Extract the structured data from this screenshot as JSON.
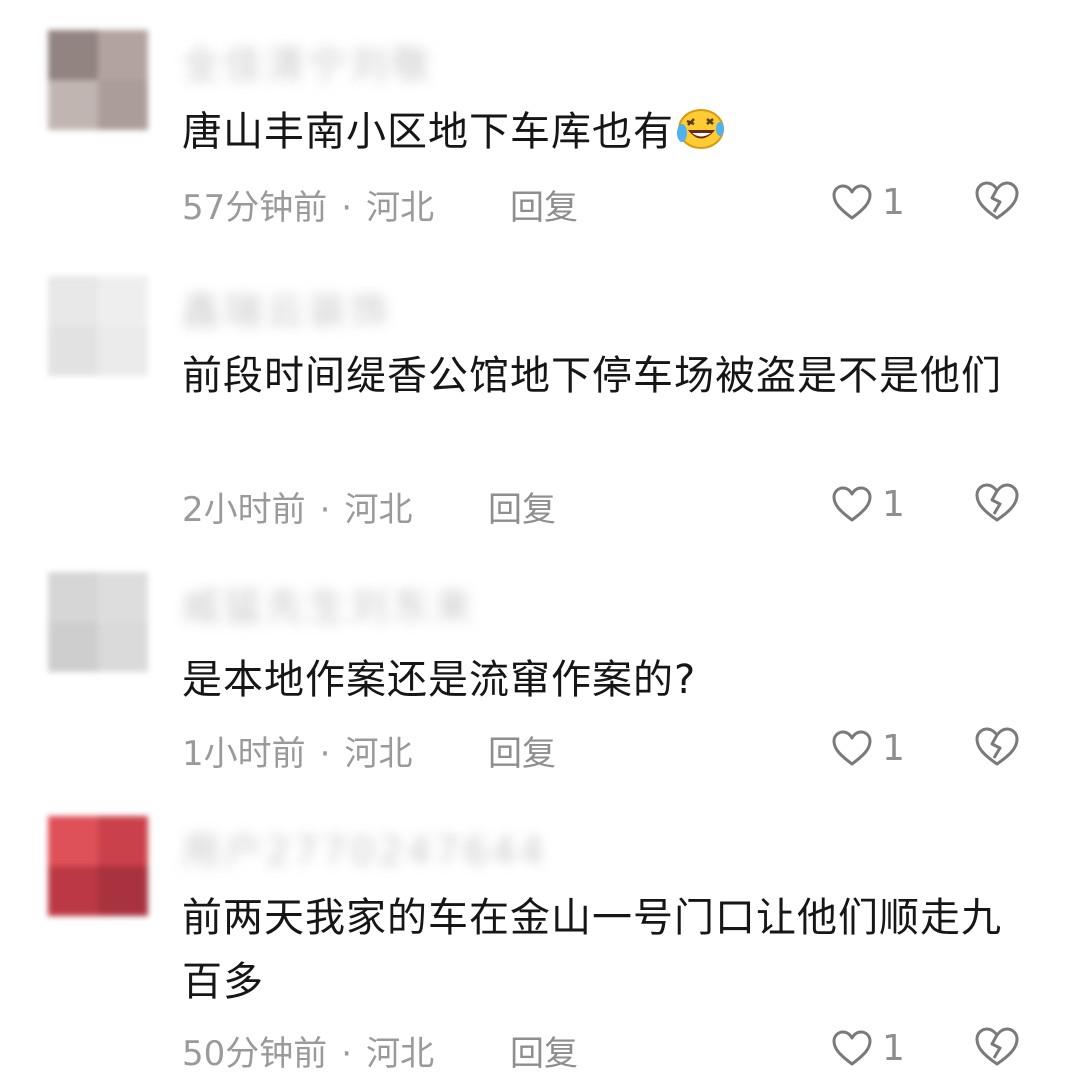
{
  "comments": [
    {
      "username": "全佳清宁刘敬",
      "text": "唐山丰南小区地下车库也有",
      "emoji": "laughing-crying-emoji",
      "time": "57分钟前",
      "location": "河北",
      "reply_label": "回复",
      "likes": "1",
      "avatar_colors": [
        "#7f6f6c",
        "#a69490",
        "#b7a9a5",
        "#9d8c88"
      ]
    },
    {
      "username": "鑫瑞云装饰",
      "text": "前段时间缇香公馆地下停车场被盗是不是他们",
      "time": "2小时前",
      "location": "河北",
      "reply_label": "回复",
      "likes": "1",
      "avatar_colors": [
        "#e4e4e4",
        "#ececec",
        "#dedede",
        "#e8e8e8"
      ]
    },
    {
      "username": "威猛先生刘东来",
      "text": "是本地作案还是流窜作案的?",
      "time": "1小时前",
      "location": "河北",
      "reply_label": "回复",
      "likes": "1",
      "avatar_colors": [
        "#cfcfcf",
        "#d8d8d8",
        "#c6c6c6",
        "#d4d4d4"
      ]
    },
    {
      "username": "用户2770247644",
      "text": "前两天我家的车在金山一号门口让他们顺走九百多",
      "time": "50分钟前",
      "location": "河北",
      "reply_label": "回复",
      "likes": "1",
      "avatar_colors": [
        "#d9333c",
        "#c2202c",
        "#b01624",
        "#9a0f1d"
      ]
    }
  ],
  "icons": {
    "like": "heart-outline-icon",
    "dislike": "broken-heart-icon"
  },
  "colors": {
    "text": "#161616",
    "meta": "#9a9a9a",
    "icon": "#7a7a7a"
  }
}
